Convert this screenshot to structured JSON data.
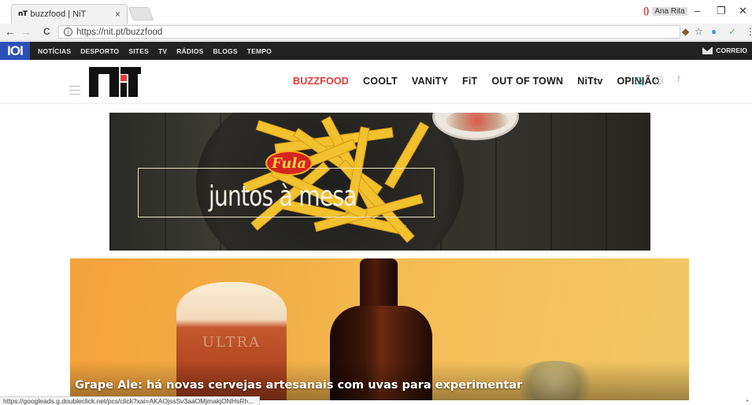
{
  "browser": {
    "tab_title": "buzzfood | NiT",
    "tab_favicon": "nT",
    "tab_close": "×",
    "url": "https://nit.pt/buzzfood",
    "profile_name": "Ana Rita",
    "back": "←",
    "forward": "→",
    "reload": "C",
    "info": "i",
    "star": "☆",
    "check": "✓",
    "menu": "⋮",
    "minimize": "–",
    "restore": "❐",
    "close": "✕",
    "status_url": "https://googleads.g.doubleclick.net/pcs/click?xai=AKAOjssSv3aaOMjmakjONHsRh..."
  },
  "topbar": {
    "logo": "IOI",
    "links": [
      "NOTÍCIAS",
      "DESPORTO",
      "SITES",
      "TV",
      "RÁDIOS",
      "BLOGS",
      "TEMPO"
    ],
    "correio": "CORREIO"
  },
  "header": {
    "nav": [
      "BUZZFOOD",
      "COOLT",
      "VANiTY",
      "FiT",
      "OUT OF TOWN",
      "NiTtv",
      "OPINIÃO"
    ],
    "active_index": 0,
    "social_facebook": "f"
  },
  "ad": {
    "brand": "Fula",
    "slogan": "juntos à mesa"
  },
  "article": {
    "title": "Grape Ale: há novas cervejas artesanais com uvas para experimentar",
    "glass_print": "ULTRA"
  },
  "colors": {
    "accent": "#e53935",
    "topbar": "#222222",
    "logo101": "#2c4fb8",
    "search": "#3aa6a0"
  }
}
